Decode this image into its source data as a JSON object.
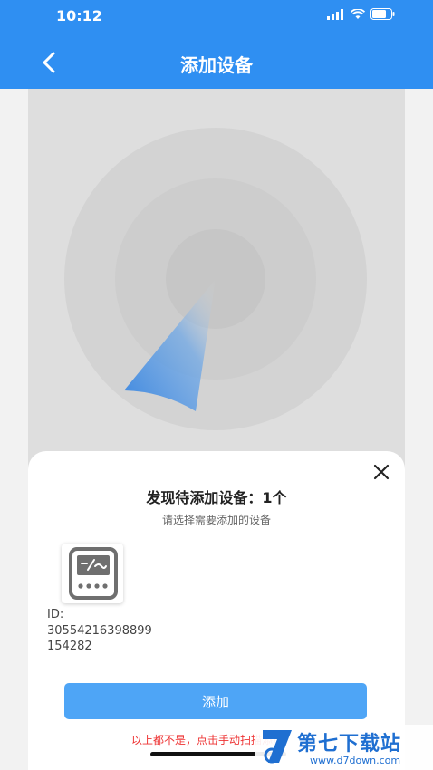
{
  "status_bar": {
    "time": "10:12"
  },
  "header": {
    "title": "添加设备"
  },
  "sheet": {
    "found_title": "发现待添加设备：1个",
    "subtitle": "请选择需要添加的设备",
    "device": {
      "id_label": "ID:",
      "id_value": "30554216398899154282"
    },
    "add_label": "添加",
    "manual_text": "以上都不是，点击手动扫描添加"
  },
  "watermark": {
    "name": "第七下载站",
    "url": "www.d7down.com"
  },
  "colors": {
    "primary": "#2f8ff2",
    "button": "#4ea5f6",
    "link": "#e33333"
  }
}
